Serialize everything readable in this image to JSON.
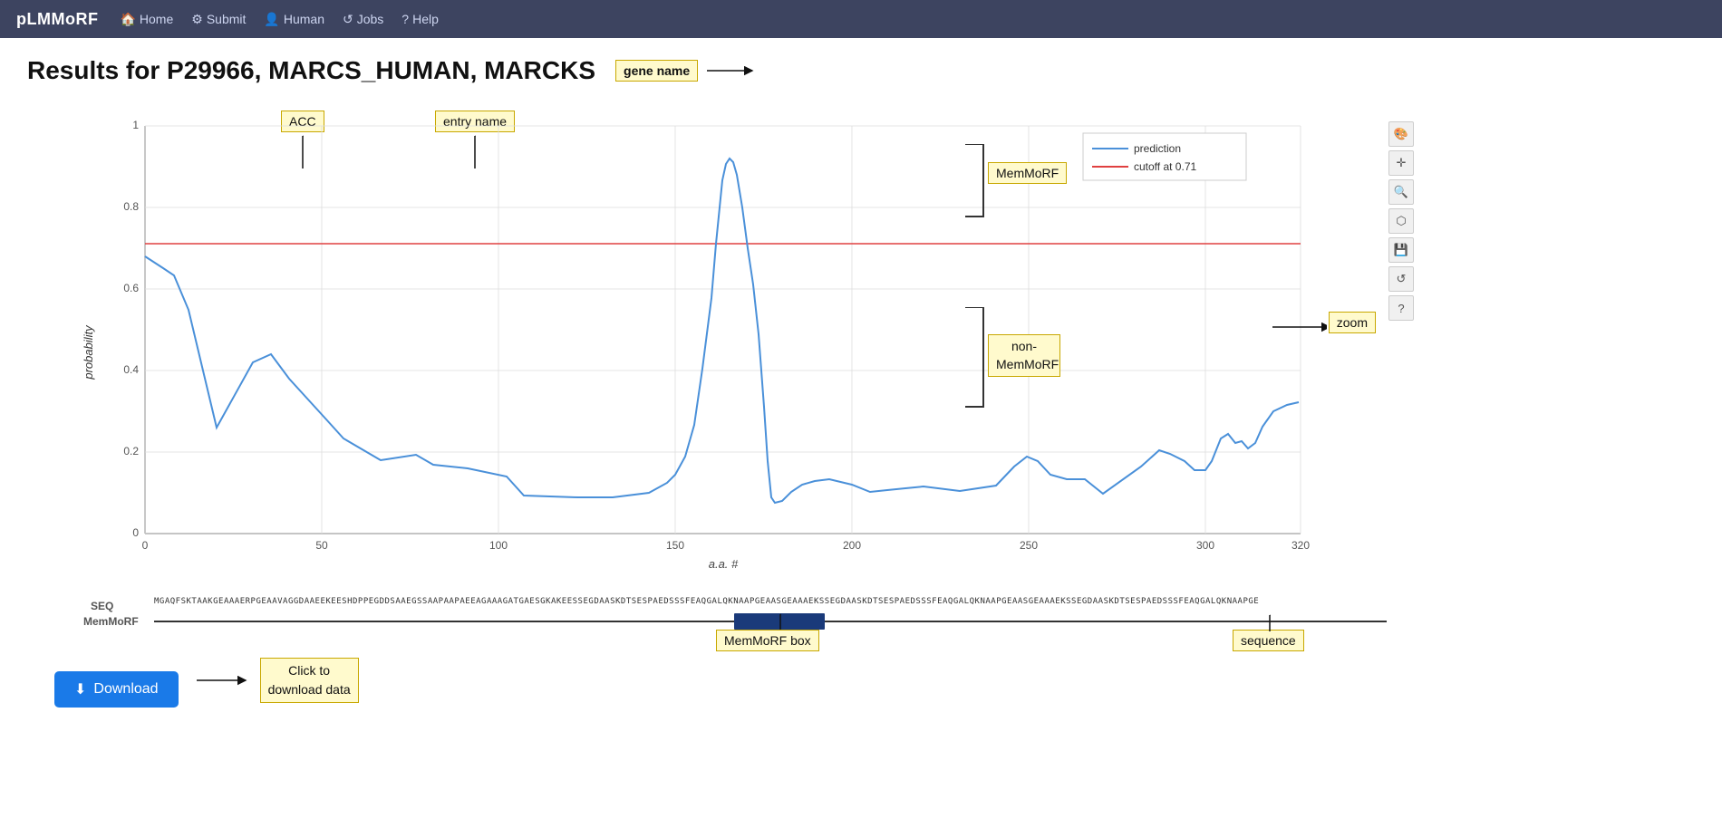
{
  "app": {
    "brand": "pLMMoRF",
    "nav_items": [
      {
        "label": "Home",
        "icon": "🏠"
      },
      {
        "label": "Submit",
        "icon": "⚙"
      },
      {
        "label": "Human",
        "icon": "👤"
      },
      {
        "label": "Jobs",
        "icon": "↺"
      },
      {
        "label": "Help",
        "icon": "?"
      }
    ]
  },
  "page": {
    "title": "Results for P29966, MARCS_HUMAN, MARCKS",
    "acc": "P29966",
    "entry_name": "MARCS_HUMAN",
    "gene_name": "MARCKS",
    "annotations": {
      "acc_label": "ACC",
      "entry_name_label": "entry name",
      "gene_name_label": "gene name",
      "memmorf_label": "MemMoRF",
      "non_memmorf_label": "non-\nMemMoRF",
      "zoom_label": "zoom",
      "memmorf_box_label": "MemMoRF box",
      "sequence_label": "sequence",
      "click_to_download_label": "Click to\ndownload data",
      "download_label": "Download"
    }
  },
  "chart": {
    "y_label": "probability",
    "x_label": "a.a. #",
    "y_ticks": [
      "0",
      "0.2",
      "0.4",
      "0.6",
      "0.8",
      "1"
    ],
    "x_ticks": [
      "0",
      "50",
      "100",
      "150",
      "200",
      "250",
      "300"
    ],
    "legend": {
      "prediction_label": "prediction",
      "prediction_color": "#4a90d9",
      "cutoff_label": "cutoff at 0.71",
      "cutoff_color": "#e04040"
    },
    "cutoff_value": 0.71
  },
  "toolbar": {
    "tools": [
      "🎨",
      "+",
      "🔍",
      "🖇",
      "💾",
      "↺",
      "?"
    ]
  },
  "download": {
    "button_label": "⬇ Download"
  }
}
